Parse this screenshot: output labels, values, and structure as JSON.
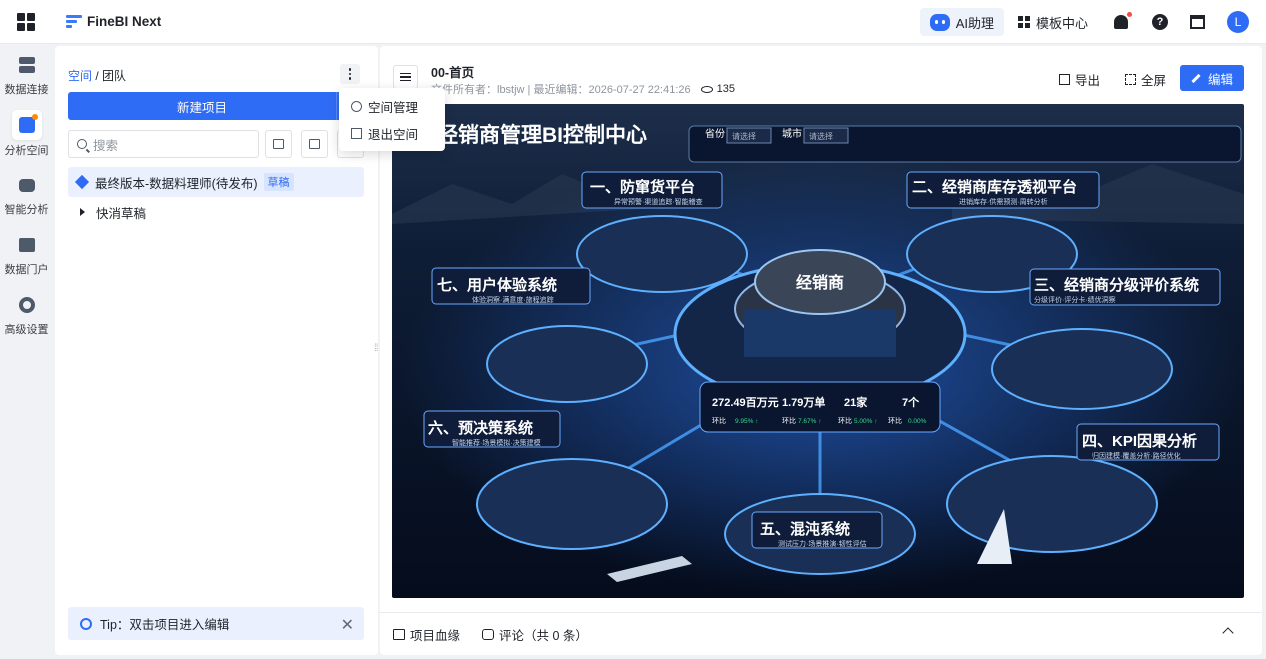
{
  "app": {
    "brand": "FineBI Next"
  },
  "topbar": {
    "ai_label": "AI助理",
    "template_label": "模板中心",
    "avatar_letter": "L"
  },
  "nav": [
    {
      "label": "数据连接",
      "icon": "database-icon"
    },
    {
      "label": "分析空间",
      "icon": "analysis-chart-icon",
      "active": true
    },
    {
      "label": "智能分析",
      "icon": "robot-icon"
    },
    {
      "label": "数据门户",
      "icon": "portal-board-icon"
    },
    {
      "label": "高级设置",
      "icon": "gear-icon"
    }
  ],
  "panel": {
    "crumb_link": "空间",
    "crumb_sep": "/",
    "crumb_current": "团队",
    "new_project": "新建项目",
    "search_placeholder": "搜索",
    "tree": [
      {
        "label": "最终版本-数据料理师(待发布)",
        "badge": "草稿"
      },
      {
        "label": "快消草稿"
      }
    ],
    "tip": "Tip：双击项目进入编辑"
  },
  "menu": {
    "items": [
      "空间管理",
      "退出空间"
    ]
  },
  "doc": {
    "title": "00-首页",
    "meta": "文件所有者：lbstjw | 最近编辑：2026-07-27 22:41:26",
    "views": "135",
    "export_label": "导出",
    "fullscreen_label": "全屏",
    "edit_label": "编辑"
  },
  "dashboard": {
    "title": "经销商管理BI控制中心",
    "filter_province": "省份",
    "filter_city": "城市",
    "select_placeholder": "请选择",
    "center_label": "经销商",
    "modules": [
      {
        "title": "一、防窜货平台",
        "sub": "异常预警·渠道追踪·智能稽查"
      },
      {
        "title": "二、经销商库存透视平台",
        "sub": "进销库存·供需预测·周转分析"
      },
      {
        "title": "三、经销商分级评价系统",
        "sub": "分级评价·评分卡·绩优洞察"
      },
      {
        "title": "四、KPI因果分析",
        "sub": "归因建模·覆盖分析·路径优化"
      },
      {
        "title": "五、混沌系统",
        "sub": "测试压力·场景推演·韧性评估"
      },
      {
        "title": "六、预决策系统",
        "sub": "智能推荐·场景模拟·决策建模"
      },
      {
        "title": "七、用户体验系统",
        "sub": "体验洞察·满意度·旅程追踪"
      }
    ],
    "kpis": [
      {
        "value": "272.49百万元",
        "ratio_label": "环比",
        "ratio": "9.95% ↑"
      },
      {
        "value": "1.79万单",
        "ratio_label": "环比",
        "ratio": "7.67% ↑"
      },
      {
        "value": "21家",
        "ratio_label": "环比",
        "ratio": "5.00% ↑"
      },
      {
        "value": "7个",
        "ratio_label": "环比",
        "ratio": "0.00%"
      }
    ]
  },
  "bottom": {
    "lineage": "项目血缘",
    "comments": "评论（共 0 条）"
  }
}
